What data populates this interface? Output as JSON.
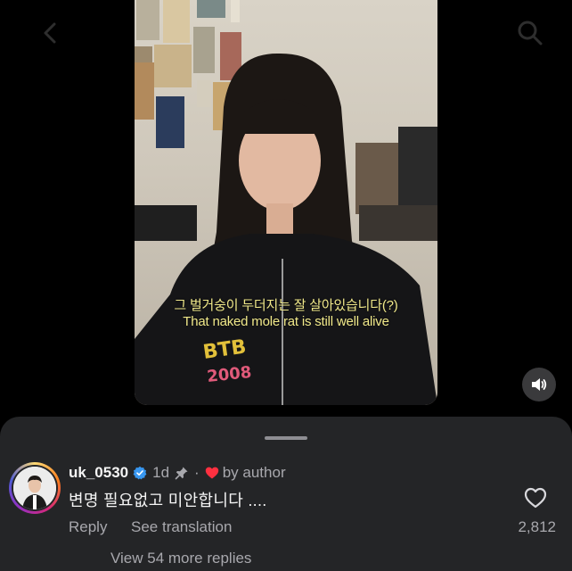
{
  "video": {
    "subtitle_ko": "그 벌거숭이 두더지는 잘 살아있습니다(?)",
    "subtitle_en": "That naked mole rat is still well alive"
  },
  "comment": {
    "username": "uk_0530",
    "time": "1d",
    "separator": "·",
    "liked_by": "by author",
    "text": "변명 필요없고 미안합니다 ....",
    "reply_label": "Reply",
    "translate_label": "See translation",
    "like_count": "2,812",
    "view_replies": "View 54 more replies"
  },
  "icons": {
    "back": "back-arrow-icon",
    "search": "search-icon",
    "sound": "speaker-icon",
    "verified": "verified-badge-icon",
    "pin": "pin-icon",
    "heart_red": "heart-filled-icon",
    "like": "heart-outline-icon"
  },
  "colors": {
    "sheet_bg": "#242527",
    "secondary_text": "#a8a8ad",
    "verified_blue": "#3897f0",
    "heart_red": "#ff3040",
    "subtitle_yellow": "#f1e98a"
  }
}
